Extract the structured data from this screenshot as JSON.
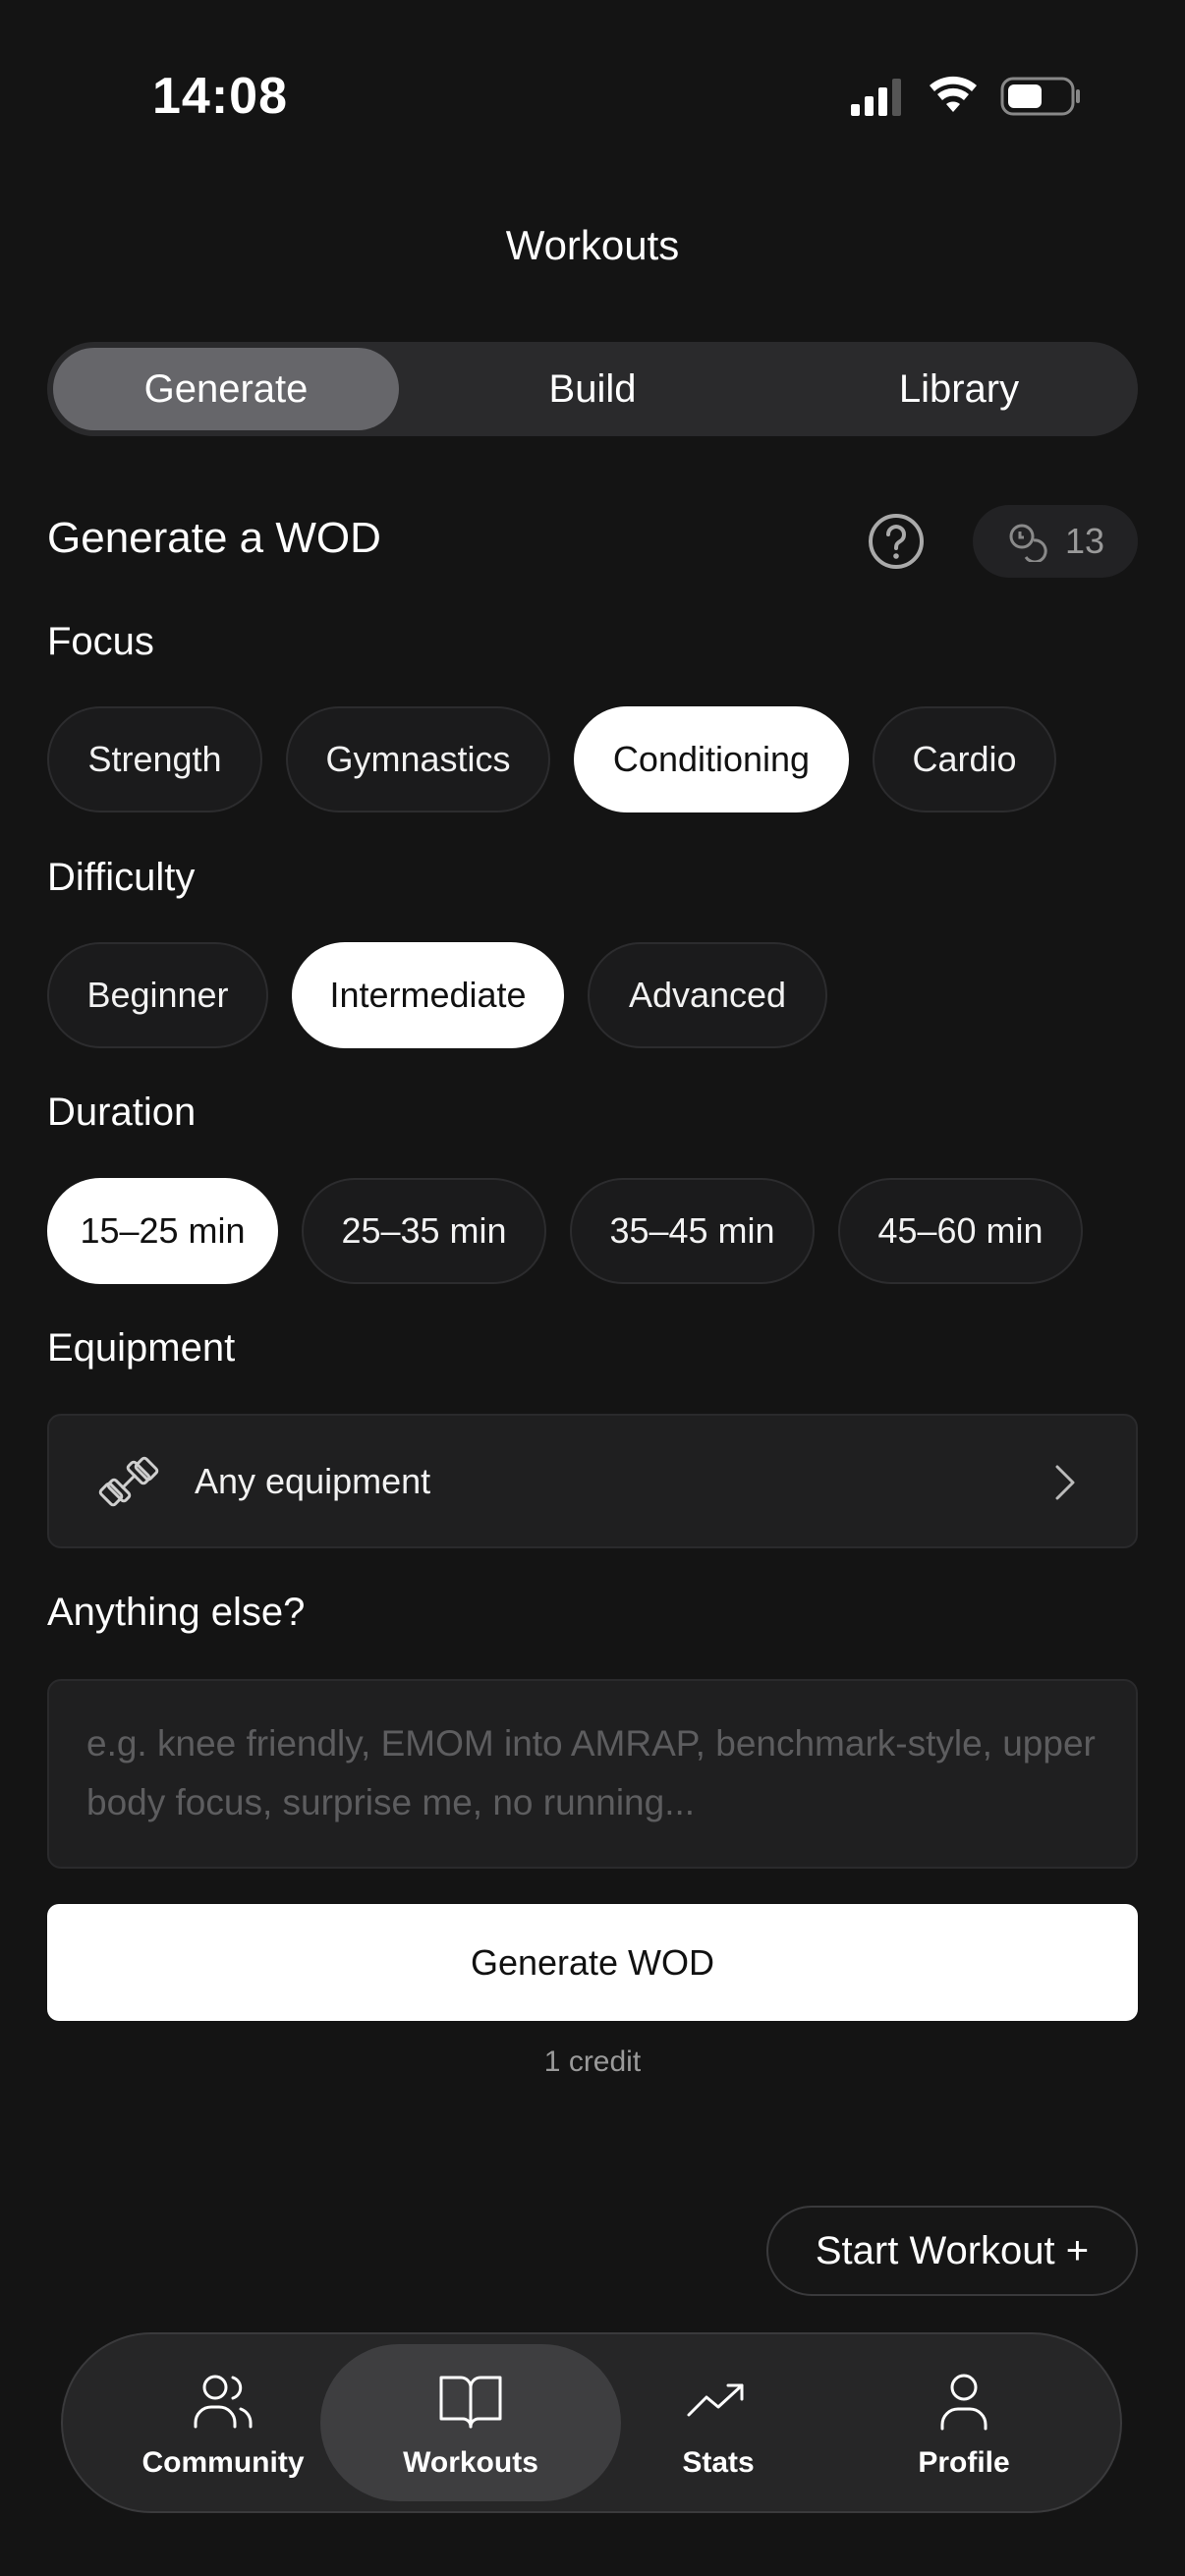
{
  "status_bar": {
    "time": "14:08"
  },
  "page_title": "Workouts",
  "segments": [
    {
      "label": "Generate",
      "active": true
    },
    {
      "label": "Build",
      "active": false
    },
    {
      "label": "Library",
      "active": false
    }
  ],
  "section_title": "Generate a WOD",
  "credits_count": "13",
  "focus": {
    "label": "Focus",
    "options": [
      "Strength",
      "Gymnastics",
      "Conditioning",
      "Cardio"
    ],
    "selected": "Conditioning"
  },
  "difficulty": {
    "label": "Difficulty",
    "options": [
      "Beginner",
      "Intermediate",
      "Advanced"
    ],
    "selected": "Intermediate"
  },
  "duration": {
    "label": "Duration",
    "options": [
      "15–25 min",
      "25–35 min",
      "35–45 min",
      "45–60 min"
    ],
    "selected": "15–25 min"
  },
  "equipment": {
    "label": "Equipment",
    "value": "Any equipment"
  },
  "notes": {
    "label": "Anything else?",
    "placeholder": "e.g. knee friendly, EMOM into AMRAP, benchmark-style, upper body focus, surprise me, no running..."
  },
  "generate_button": "Generate WOD",
  "credit_note": "1 credit",
  "start_workout_button": "Start Workout +",
  "tabs": [
    {
      "label": "Community",
      "icon": "users-icon",
      "active": false
    },
    {
      "label": "Workouts",
      "icon": "book-icon",
      "active": true
    },
    {
      "label": "Stats",
      "icon": "trending-up-icon",
      "active": false
    },
    {
      "label": "Profile",
      "icon": "user-icon",
      "active": false
    }
  ]
}
